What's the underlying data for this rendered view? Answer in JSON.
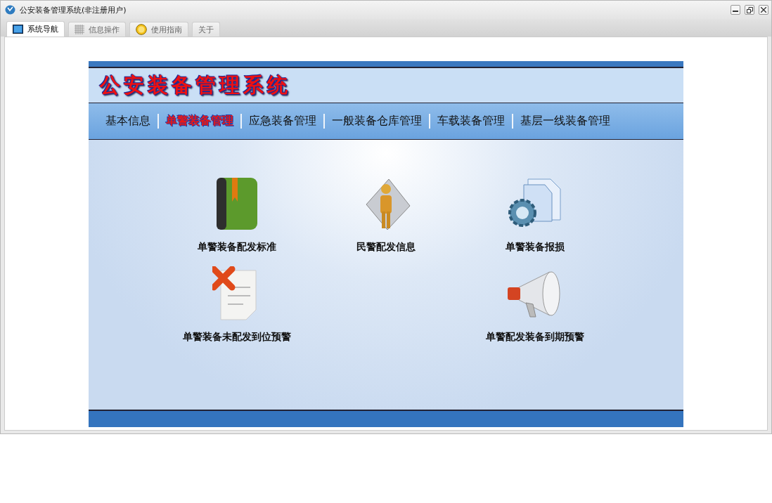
{
  "window": {
    "title": "公安装备管理系统(非注册用户)"
  },
  "tabs": [
    {
      "label": "系统导航",
      "selected": true,
      "kind": "monitor"
    },
    {
      "label": "信息操作",
      "selected": false,
      "kind": "grid"
    },
    {
      "label": "使用指南",
      "selected": false,
      "kind": "coin"
    },
    {
      "label": "关于",
      "selected": false,
      "kind": "plain"
    }
  ],
  "banner": {
    "title": "公安装备管理系统"
  },
  "nav": [
    {
      "label": "基本信息",
      "selected": false
    },
    {
      "label": "单警装备管理",
      "selected": true
    },
    {
      "label": "应急装备管理",
      "selected": false
    },
    {
      "label": "一般装备仓库管理",
      "selected": false
    },
    {
      "label": "车载装备管理",
      "selected": false
    },
    {
      "label": "基层一线装备管理",
      "selected": false
    }
  ],
  "rows": [
    [
      {
        "label": "单警装备配发标准",
        "kind": "book"
      },
      {
        "label": "民警配发信息",
        "kind": "person"
      },
      {
        "label": "单警装备报损",
        "kind": "gear"
      }
    ],
    [
      {
        "label": "单警装备未配发到位预警",
        "kind": "cancel"
      },
      {
        "label": "单警配发装备到期预警",
        "kind": "megaphone"
      }
    ]
  ]
}
